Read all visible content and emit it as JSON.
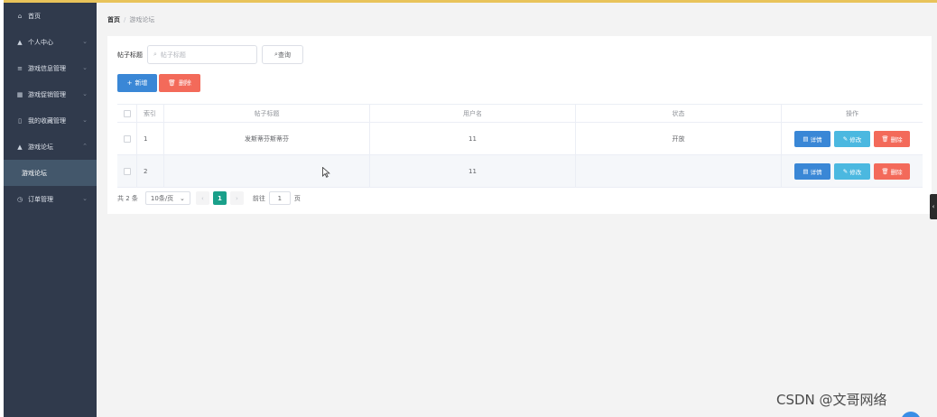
{
  "sidebar": {
    "items": [
      {
        "label": "首页",
        "icon": "home-icon",
        "glyph": "⌂"
      },
      {
        "label": "个人中心",
        "icon": "user-icon",
        "glyph": "▲",
        "chevron": "⌄"
      },
      {
        "label": "游戏信息管理",
        "icon": "list-icon",
        "glyph": "≡",
        "chevron": "⌄"
      },
      {
        "label": "游戏促销管理",
        "icon": "card-icon",
        "glyph": "▦",
        "chevron": "⌄"
      },
      {
        "label": "我的收藏管理",
        "icon": "phone-icon",
        "glyph": "▯",
        "chevron": "⌄"
      },
      {
        "label": "游戏论坛",
        "icon": "user-icon",
        "glyph": "▲",
        "chevron": "⌃"
      }
    ],
    "sub_item": {
      "label": "游戏论坛"
    },
    "after": {
      "label": "订单管理",
      "icon": "clock-icon",
      "glyph": "◷",
      "chevron": "⌄"
    }
  },
  "breadcrumb": {
    "home": "首页",
    "sep": "/",
    "current": "游戏论坛"
  },
  "search": {
    "label": "帖子标题",
    "placeholder": "帖子标题",
    "search_icon": "⌕",
    "button_label": "查询"
  },
  "actions": {
    "add_label": "新增",
    "add_glyph": "+",
    "delete_label": "删除",
    "delete_glyph": "🗑"
  },
  "table": {
    "headers": {
      "index": "索引",
      "title": "帖子标题",
      "username": "用户名",
      "status": "状态",
      "ops": "操作"
    },
    "rows": [
      {
        "index": "1",
        "title": "发斯蒂芬斯蒂芬",
        "username": "11",
        "status": "开放"
      },
      {
        "index": "2",
        "title": "",
        "username": "11",
        "status": ""
      }
    ],
    "row_ops": {
      "detail": "详情",
      "edit": "修改",
      "delete": "删除",
      "detail_glyph": "▤",
      "edit_glyph": "✎",
      "delete_glyph": "🗑"
    }
  },
  "pagination": {
    "total": "共 2 条",
    "page_size": "10条/页",
    "size_chevron": "⌄",
    "prev": "‹",
    "current_page": "1",
    "next": "›",
    "goto_label": "前往",
    "goto_value": "1",
    "page_suffix": "页"
  },
  "side_tab_glyph": "‹",
  "watermark": "CSDN @文哥网络",
  "colors": {
    "sidebar_bg": "#303a4c",
    "sub_item_bg": "#43576b",
    "primary": "#3a87d6",
    "danger": "#f36a5a",
    "info": "#4bb8e0",
    "page_active": "#1aa08a",
    "top_accent": "#e8c35a"
  }
}
